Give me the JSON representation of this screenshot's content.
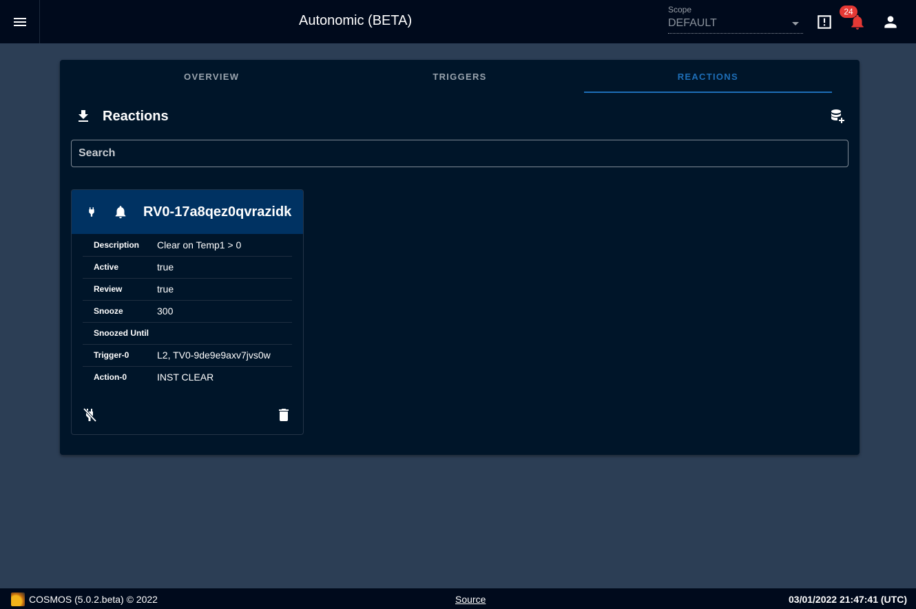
{
  "appbar": {
    "title": "Autonomic (BETA)",
    "scope_label": "Scope",
    "scope_value": "DEFAULT",
    "notifications_count": "24",
    "icons": [
      "menu-icon",
      "alert-box-icon",
      "bell-icon",
      "account-icon"
    ]
  },
  "tabs": [
    {
      "label": "OVERVIEW",
      "active": false
    },
    {
      "label": "TRIGGERS",
      "active": false
    },
    {
      "label": "REACTIONS",
      "active": true
    }
  ],
  "section": {
    "title": "Reactions",
    "icons": [
      "download-icon",
      "database-plus-icon"
    ]
  },
  "search": {
    "placeholder": "Search",
    "value": ""
  },
  "card": {
    "title": "RV0-17a8qez0qvrazidk",
    "icons": [
      "power-plug-icon",
      "bell-icon",
      "power-plug-off-icon",
      "delete-icon"
    ],
    "rows": [
      {
        "key": "Description",
        "value": "Clear on Temp1 > 0"
      },
      {
        "key": "Active",
        "value": "true"
      },
      {
        "key": "Review",
        "value": "true"
      },
      {
        "key": "Snooze",
        "value": "300"
      },
      {
        "key": "Snoozed Until",
        "value": ""
      },
      {
        "key": "Trigger-0",
        "value": "L2, TV0-9de9e9axv7jvs0w"
      },
      {
        "key": "Action-0",
        "value": "INST CLEAR"
      }
    ]
  },
  "footer": {
    "version": "COSMOS (5.0.2.beta) © 2022",
    "source": "Source",
    "time": "03/01/2022 21:47:41 (UTC)"
  },
  "colors": {
    "appbar": "#000a1c",
    "background": "#2c3e55",
    "panel": "#001529",
    "card_header": "#003262",
    "accent": "#1e6fb8",
    "badge": "#e53935"
  }
}
